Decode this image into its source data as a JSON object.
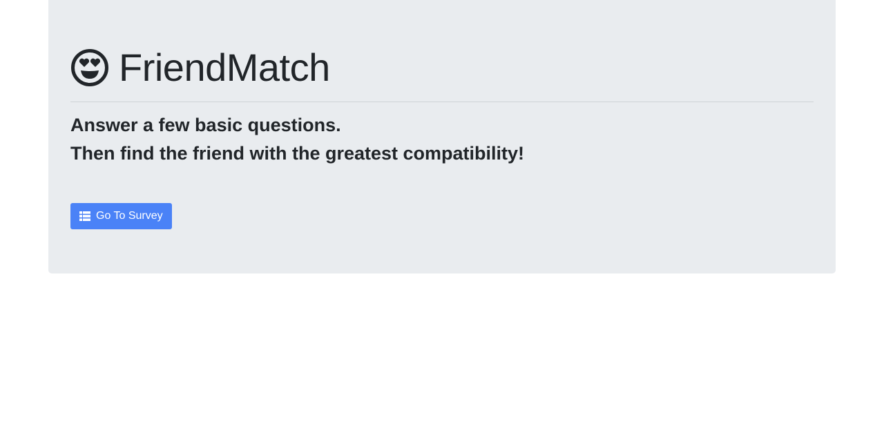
{
  "header": {
    "title": "FriendMatch",
    "logo_icon": "grin-hearts-icon"
  },
  "intro": {
    "line1": "Answer a few basic questions.",
    "line2": "Then find the friend with the greatest compatibility!"
  },
  "actions": {
    "survey_button_label": "Go To Survey",
    "survey_button_icon": "table-list-icon",
    "button_color": "#4a82f7"
  },
  "theme": {
    "panel_background": "#e9ecef",
    "text_color": "#212529"
  }
}
